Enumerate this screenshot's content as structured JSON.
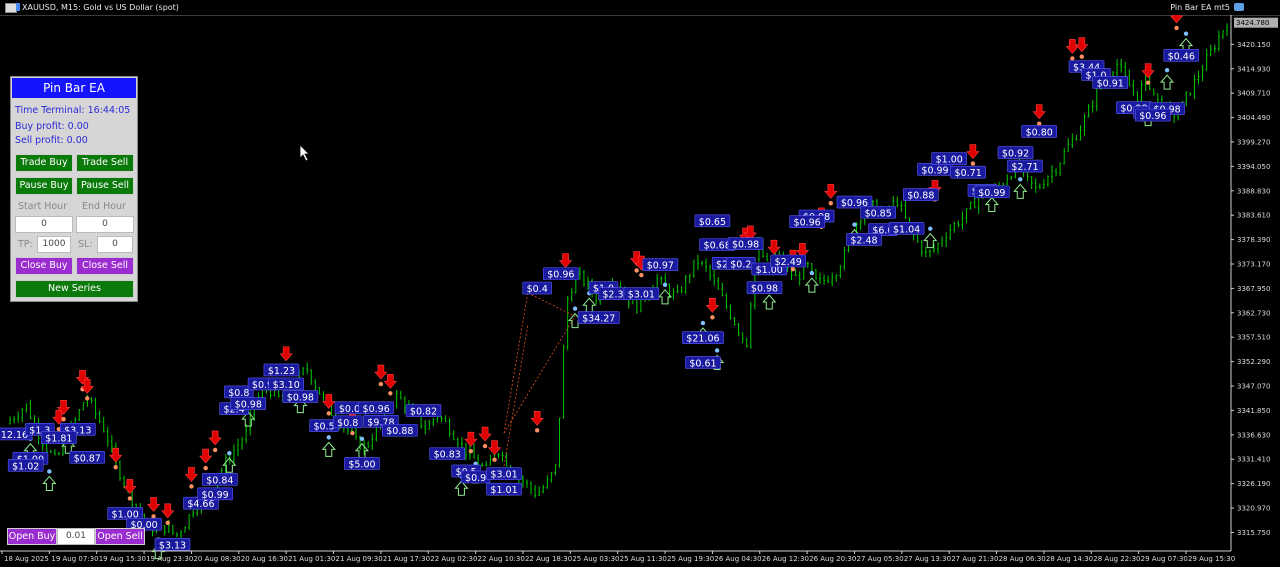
{
  "window": {
    "title": "XAUUSD, M15:  Gold vs US Dollar (spot)",
    "ea_name": "Pin Bar EA mt5",
    "current_price": "3424.780"
  },
  "panel": {
    "title": "Pin Bar EA",
    "time_terminal": "Time Terminal: 16:44:05",
    "buy_profit": "Buy profit: 0.00",
    "sell_profit": "Sell profit: 0.00",
    "trade_buy": "Trade Buy",
    "trade_sell": "Trade Sell",
    "pause_buy": "Pause Buy",
    "pause_sell": "Pause Sell",
    "start_hour_label": "Start Hour",
    "end_hour_label": "End Hour",
    "start_hour_value": "0",
    "end_hour_value": "0",
    "tp_label": "TP:",
    "tp_value": "1000",
    "sl_label": "SL:",
    "sl_value": "0",
    "close_buy": "Close Buy",
    "close_sell": "Close Sell",
    "new_series": "New Series"
  },
  "bottom_controls": {
    "open_buy": "Open Buy",
    "lot_value": "0.01",
    "open_sell": "Open Sell"
  },
  "colors": {
    "background": "#000000",
    "candles": "#00c800",
    "panel_title": "#1414ff",
    "green_button": "#0a7a0a",
    "purple_button": "#9a2cd0",
    "sell_arrow": "#e00000",
    "buy_arrow": "#90ee90",
    "profit_label": "#1a1aa0"
  },
  "icons": [
    "window-menu-icon",
    "chart-icon",
    "cap-icon",
    "mouse-cursor-icon",
    "sell-arrow-icon",
    "buy-arrow-icon"
  ],
  "chart_data": {
    "type": "candlestick",
    "symbol": "XAUUSD",
    "timeframe": "M15",
    "ylim": [
      3312.0,
      3426.0
    ],
    "y_ticks": [
      "3420.150",
      "3414.930",
      "3409.710",
      "3404.490",
      "3399.270",
      "3394.050",
      "3388.830",
      "3383.610",
      "3378.390",
      "3373.170",
      "3367.950",
      "3362.730",
      "3357.510",
      "3352.290",
      "3347.070",
      "3341.850",
      "3336.630",
      "3331.410",
      "3326.190",
      "3320.970",
      "3315.750"
    ],
    "x_ticks": [
      "18 Aug 2025",
      "19 Aug 07:30",
      "19 Aug 15:30",
      "19 Aug 23:30",
      "20 Aug 08:30",
      "20 Aug 16:30",
      "21 Aug 01:30",
      "21 Aug 09:30",
      "21 Aug 17:30",
      "22 Aug 02:30",
      "22 Aug 10:30",
      "22 Aug 18:30",
      "25 Aug 03:30",
      "25 Aug 11:30",
      "25 Aug 19:30",
      "26 Aug 04:30",
      "26 Aug 12:30",
      "26 Aug 20:30",
      "27 Aug 05:30",
      "27 Aug 13:30",
      "27 Aug 21:30",
      "28 Aug 06:30",
      "28 Aug 14:30",
      "28 Aug 22:30",
      "29 Aug 07:30",
      "29 Aug 15:30"
    ],
    "price_path": [
      3339,
      3341,
      3343,
      3338,
      3334,
      3331,
      3336,
      3340,
      3345,
      3341,
      3337,
      3330,
      3326,
      3321,
      3318,
      3316,
      3317,
      3315,
      3318,
      3322,
      3324,
      3327,
      3331,
      3334,
      3337,
      3344,
      3347,
      3345,
      3343,
      3348,
      3351,
      3347,
      3343,
      3340,
      3338,
      3335,
      3334,
      3338,
      3342,
      3345,
      3343,
      3340,
      3338,
      3341,
      3339,
      3336,
      3333,
      3331,
      3329,
      3334,
      3331,
      3328,
      3326,
      3324,
      3326,
      3330,
      3365,
      3371,
      3369,
      3366,
      3370,
      3369,
      3366,
      3364,
      3367,
      3370,
      3368,
      3366,
      3370,
      3374,
      3372,
      3368,
      3364,
      3360,
      3356,
      3378,
      3373,
      3375,
      3372,
      3370,
      3373,
      3369,
      3370,
      3372,
      3376,
      3382,
      3386,
      3385,
      3384,
      3387,
      3382,
      3378,
      3375,
      3377,
      3380,
      3382,
      3384,
      3387,
      3390,
      3389,
      3392,
      3394,
      3391,
      3389,
      3392,
      3394,
      3398,
      3401,
      3405,
      3410,
      3414,
      3416,
      3412,
      3409,
      3413,
      3408,
      3406,
      3405,
      3409,
      3413,
      3417,
      3421,
      3425
    ],
    "profit_labels": [
      {
        "text": "$12.16",
        "x": 0.2,
        "y": 3336.6
      },
      {
        "text": "$1.3",
        "x": 0.8,
        "y": 3337.6
      },
      {
        "text": "$3.13",
        "x": 1.6,
        "y": 3337.6
      },
      {
        "text": "$1.00",
        "x": 0.6,
        "y": 3331.4
      },
      {
        "text": "$1.02",
        "x": 0.5,
        "y": 3329.9
      },
      {
        "text": "$1.81",
        "x": 1.2,
        "y": 3335.8
      },
      {
        "text": "$0.87",
        "x": 1.8,
        "y": 3331.6
      },
      {
        "text": "$1.00",
        "x": 2.6,
        "y": 3319.6
      },
      {
        "text": "$0.00",
        "x": 3.0,
        "y": 3317.3
      },
      {
        "text": "$3.13",
        "x": 3.6,
        "y": 3313.0
      },
      {
        "text": "$4.66",
        "x": 4.2,
        "y": 3321.8
      },
      {
        "text": "$0.99",
        "x": 4.5,
        "y": 3323.8
      },
      {
        "text": "$0.84",
        "x": 4.6,
        "y": 3326.9
      },
      {
        "text": "$2.4",
        "x": 4.9,
        "y": 3342.0
      },
      {
        "text": "$0.8",
        "x": 5.0,
        "y": 3345.6
      },
      {
        "text": "$0.98",
        "x": 5.2,
        "y": 3343.1
      },
      {
        "text": "$0.9",
        "x": 5.5,
        "y": 3347.3
      },
      {
        "text": "$3.10",
        "x": 6.0,
        "y": 3347.3
      },
      {
        "text": "$1.23",
        "x": 5.9,
        "y": 3350.3
      },
      {
        "text": "$0.98",
        "x": 6.3,
        "y": 3344.6
      },
      {
        "text": "$0.5",
        "x": 6.8,
        "y": 3338.4
      },
      {
        "text": "$0.8",
        "x": 7.3,
        "y": 3339.2
      },
      {
        "text": "$0.00",
        "x": 7.4,
        "y": 3342.2
      },
      {
        "text": "$0.96",
        "x": 7.9,
        "y": 3342.2
      },
      {
        "text": "$9.78",
        "x": 8.0,
        "y": 3339.3
      },
      {
        "text": "$0.82",
        "x": 8.9,
        "y": 3341.6
      },
      {
        "text": "$0.88",
        "x": 8.4,
        "y": 3337.4
      },
      {
        "text": "$5.00",
        "x": 7.6,
        "y": 3330.3
      },
      {
        "text": "$0.83",
        "x": 9.4,
        "y": 3332.4
      },
      {
        "text": "$0.5",
        "x": 9.8,
        "y": 3328.7
      },
      {
        "text": "$0.9",
        "x": 10.0,
        "y": 3327.4
      },
      {
        "text": "$3.01",
        "x": 10.6,
        "y": 3328.1
      },
      {
        "text": "$1.01",
        "x": 10.6,
        "y": 3324.8
      },
      {
        "text": "$0.96",
        "x": 11.8,
        "y": 3370.9
      },
      {
        "text": "$0.4",
        "x": 11.3,
        "y": 3367.8
      },
      {
        "text": "$34.27",
        "x": 12.6,
        "y": 3361.5
      },
      {
        "text": "$1.0",
        "x": 12.7,
        "y": 3367.9
      },
      {
        "text": "$2.3",
        "x": 12.9,
        "y": 3366.6
      },
      {
        "text": "$3.01",
        "x": 13.5,
        "y": 3366.6
      },
      {
        "text": "$0.97",
        "x": 13.9,
        "y": 3372.8
      },
      {
        "text": "$21.06",
        "x": 14.8,
        "y": 3357.2
      },
      {
        "text": "$0.61",
        "x": 14.8,
        "y": 3351.9
      },
      {
        "text": "$0.65",
        "x": 15.0,
        "y": 3382.2
      },
      {
        "text": "$0.68",
        "x": 15.1,
        "y": 3377.1
      },
      {
        "text": "$0.98",
        "x": 15.7,
        "y": 3377.3
      },
      {
        "text": "$2.7",
        "x": 15.3,
        "y": 3373.1
      },
      {
        "text": "$0.2",
        "x": 15.6,
        "y": 3373.1
      },
      {
        "text": "$1.00",
        "x": 16.2,
        "y": 3371.9
      },
      {
        "text": "$2.49",
        "x": 16.6,
        "y": 3373.6
      },
      {
        "text": "$0.98",
        "x": 16.1,
        "y": 3367.9
      },
      {
        "text": "$0.98",
        "x": 17.2,
        "y": 3383.2
      },
      {
        "text": "$0.96",
        "x": 17.0,
        "y": 3382.0
      },
      {
        "text": "$0.96",
        "x": 18.0,
        "y": 3386.2
      },
      {
        "text": "$0.85",
        "x": 18.5,
        "y": 3384.0
      },
      {
        "text": "$6.0",
        "x": 18.6,
        "y": 3380.3
      },
      {
        "text": "$2.48",
        "x": 18.2,
        "y": 3378.2
      },
      {
        "text": "$1.04",
        "x": 19.1,
        "y": 3380.6
      },
      {
        "text": "$0.88",
        "x": 19.4,
        "y": 3387.8
      },
      {
        "text": "$0.99",
        "x": 19.7,
        "y": 3393.2
      },
      {
        "text": "$1.00",
        "x": 20.0,
        "y": 3395.5
      },
      {
        "text": "$0.71",
        "x": 20.4,
        "y": 3392.6
      },
      {
        "text": "$1.0",
        "x": 20.7,
        "y": 3388.7
      },
      {
        "text": "$0.99",
        "x": 20.9,
        "y": 3388.4
      },
      {
        "text": "$0.92",
        "x": 21.4,
        "y": 3396.8
      },
      {
        "text": "$2.71",
        "x": 21.6,
        "y": 3393.9
      },
      {
        "text": "$0.80",
        "x": 21.9,
        "y": 3401.3
      },
      {
        "text": "$3.44",
        "x": 22.9,
        "y": 3415.2
      },
      {
        "text": "$1.0",
        "x": 23.1,
        "y": 3413.5
      },
      {
        "text": "$0.91",
        "x": 23.4,
        "y": 3411.8
      },
      {
        "text": "$0.98",
        "x": 23.9,
        "y": 3406.4
      },
      {
        "text": "$0.9",
        "x": 24.2,
        "y": 3405.4
      },
      {
        "text": "$0.98",
        "x": 24.6,
        "y": 3406.2
      },
      {
        "text": "$0.96",
        "x": 24.3,
        "y": 3404.8
      },
      {
        "text": "$0.46",
        "x": 24.9,
        "y": 3417.6
      }
    ],
    "sell_arrows_x": [
      1.2,
      1.3,
      1.7,
      1.8,
      2.4,
      2.7,
      3.2,
      3.5,
      4.0,
      4.3,
      4.5,
      6.0,
      6.9,
      7.4,
      8.0,
      8.2,
      9.9,
      10.2,
      10.4,
      11.3,
      11.9,
      13.4,
      13.5,
      15.0,
      15.7,
      15.8,
      16.3,
      16.7,
      16.9,
      17.3,
      17.5,
      19.7,
      20.5,
      21.9,
      22.6,
      22.8,
      23.1,
      24.2,
      24.8
    ],
    "buy_arrows_x": [
      0.6,
      1.0,
      1.4,
      3.3,
      4.8,
      5.2,
      6.3,
      6.9,
      7.6,
      9.7,
      10.0,
      12.1,
      12.4,
      14.0,
      14.8,
      15.1,
      16.2,
      17.1,
      18.0,
      19.6,
      20.9,
      21.5,
      24.2,
      24.6,
      25.0
    ]
  }
}
